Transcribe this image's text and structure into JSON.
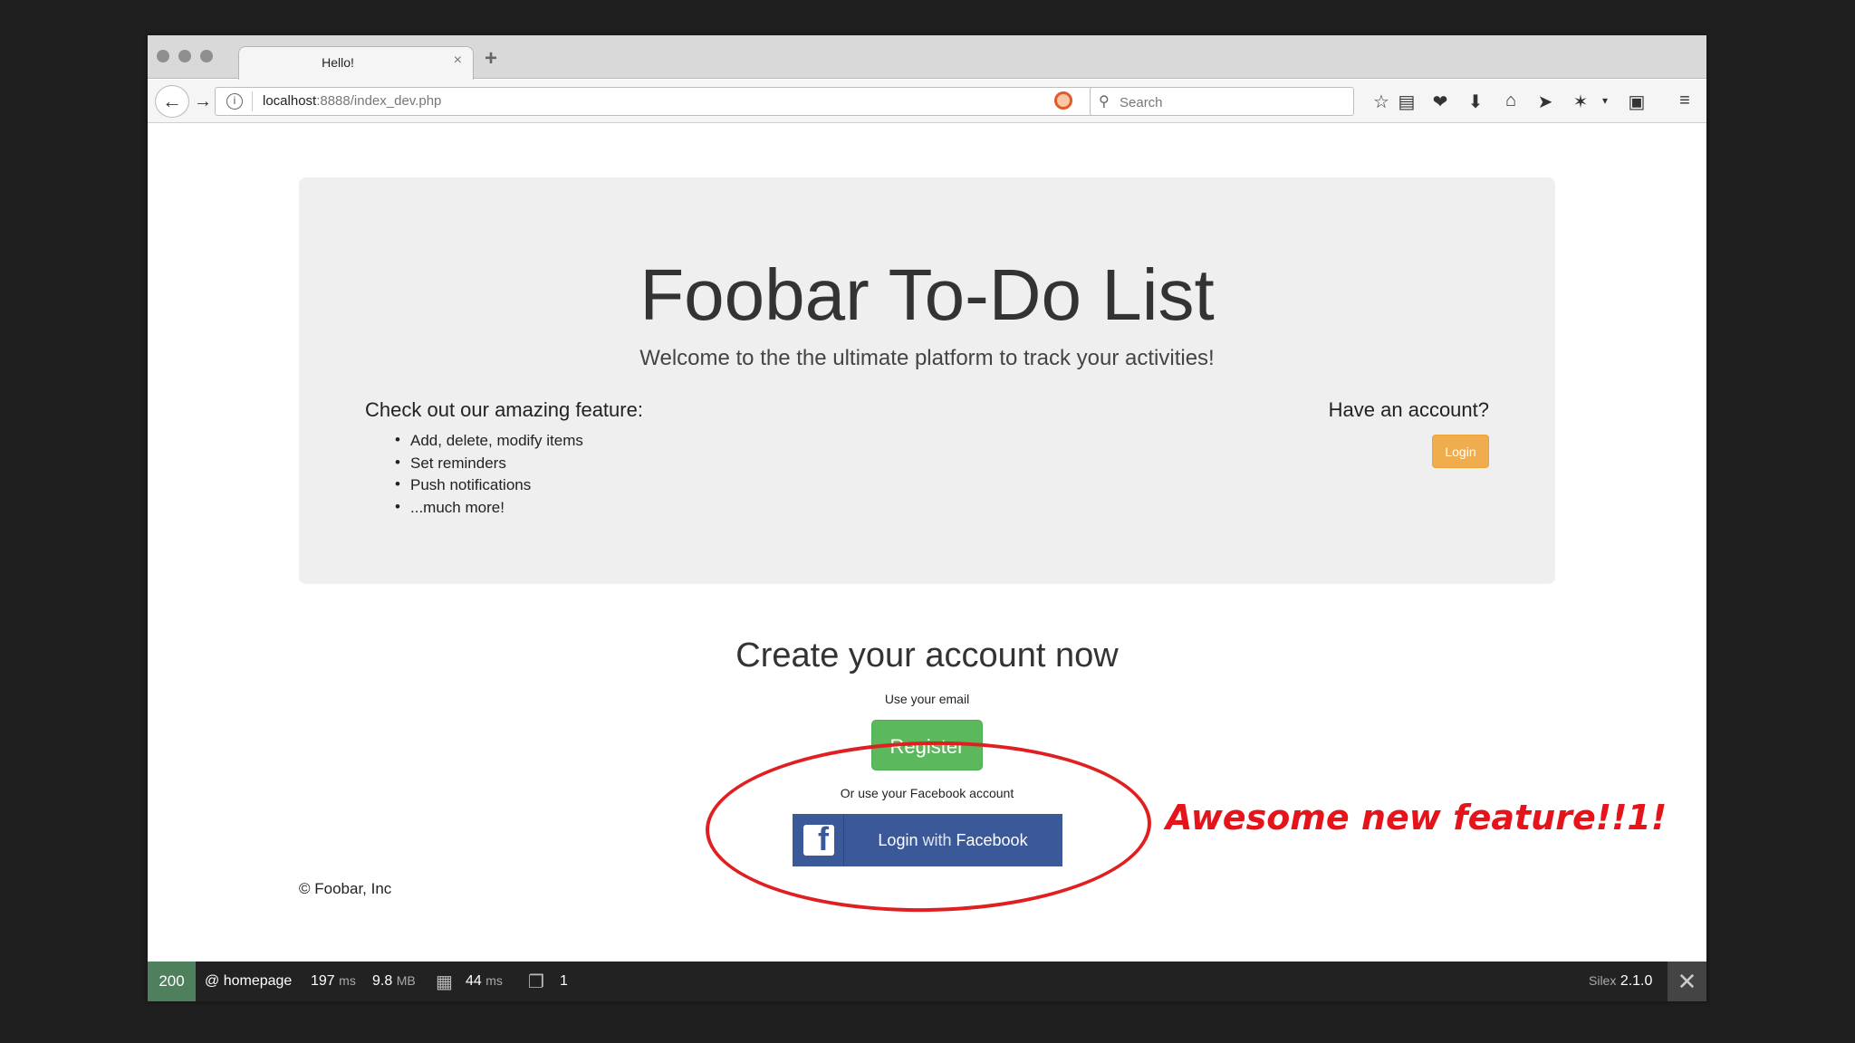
{
  "browser": {
    "tab_title": "Hello!",
    "tab_close": "×",
    "new_tab": "+",
    "url_host": "localhost",
    "url_rest": ":8888/index_dev.php",
    "search_placeholder": "Search"
  },
  "hero": {
    "title": "Foobar To-Do List",
    "subtitle": "Welcome to the the ultimate platform to track your activities!",
    "features_title": "Check out our amazing feature:",
    "features": [
      "Add, delete, modify items",
      "Set reminders",
      "Push notifications",
      "...much more!"
    ],
    "account_title": "Have an account?",
    "login_label": "Login"
  },
  "signup": {
    "title": "Create your account now",
    "use_email": "Use your email",
    "register_label": "Register",
    "or_facebook": "Or use your Facebook account",
    "fb_login": "Login",
    "fb_with": "with",
    "fb_facebook": "Facebook"
  },
  "footer": "© Foobar, Inc",
  "annotation": "Awesome new feature!!1!",
  "debug": {
    "status": "200",
    "route": "@ homepage",
    "time_value": "197",
    "time_unit": "ms",
    "memory_value": "9.8",
    "memory_unit": "MB",
    "db_value": "44",
    "db_unit": "ms",
    "count": "1",
    "framework": "Silex",
    "version": "2.1.0",
    "close": "✕"
  },
  "colors": {
    "login_orange": "#f0ad4e",
    "register_green": "#5cb85c",
    "facebook_blue": "#3b5998",
    "annotation_red": "#e5141b",
    "status_green": "#4f805d"
  }
}
